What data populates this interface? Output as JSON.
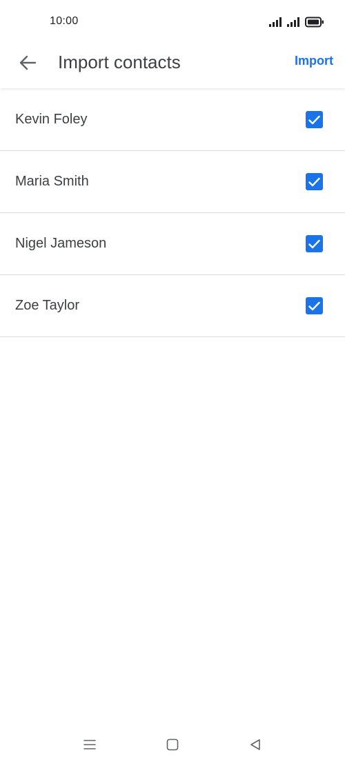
{
  "status_bar": {
    "time": "10:00"
  },
  "header": {
    "title": "Import contacts",
    "import_label": "Import",
    "accent_color": "#1a73e8"
  },
  "contacts": [
    {
      "name": "Kevin Foley",
      "checked": true
    },
    {
      "name": "Maria Smith",
      "checked": true
    },
    {
      "name": "Nigel Jameson",
      "checked": true
    },
    {
      "name": "Zoe Taylor",
      "checked": true
    }
  ],
  "icons": {
    "back": "arrow-left-icon",
    "checkbox": "checkmark-icon",
    "nav_menu": "menu-icon",
    "nav_home": "square-icon",
    "nav_back": "triangle-back-icon"
  }
}
